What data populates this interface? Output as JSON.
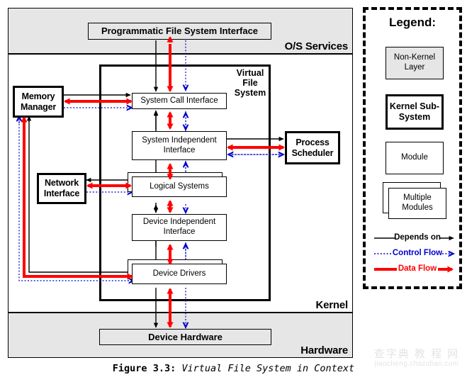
{
  "figure": {
    "caption_number": "Figure 3.3:",
    "caption_title": "Virtual File System in Context"
  },
  "layers": [
    {
      "name": "os-services",
      "label": "O/S Services",
      "fill": "#e6e6e6"
    },
    {
      "name": "kernel",
      "label": "Kernel",
      "fill": "#ffffff"
    },
    {
      "name": "hardware",
      "label": "Hardware",
      "fill": "#e6e6e6"
    }
  ],
  "subsystem": {
    "label": "Virtual\nFile\nSystem"
  },
  "nodes": {
    "programmatic_file_system_interface": "Programmatic File System Interface",
    "memory_manager": "Memory\nManager",
    "network_interface": "Network\nInterface",
    "process_scheduler": "Process\nScheduler",
    "system_call_interface": "System Call Interface",
    "system_independent_interface": "System Independent\nInterface",
    "logical_systems": "Logical Systems",
    "device_independent_interface": "Device Independent\nInterface",
    "device_drivers": "Device Drivers",
    "device_hardware": "Device Hardware"
  },
  "legend": {
    "title": "Legend:",
    "swatches": [
      {
        "name": "non-kernel-layer",
        "label": "Non-Kernel\nLayer",
        "style": "gray-thin"
      },
      {
        "name": "kernel-sub-system",
        "label": "Kernel Sub-\nSystem",
        "style": "white-bold"
      },
      {
        "name": "module",
        "label": "Module",
        "style": "white-thin"
      },
      {
        "name": "multiple-modules",
        "label": "Multiple\nModules",
        "style": "white-stacked"
      }
    ],
    "arrows": [
      {
        "name": "depends-on",
        "label": "Depends on",
        "color": "#000000",
        "line": "solid"
      },
      {
        "name": "control-flow",
        "label": "Control Flow",
        "color": "#0000cc",
        "line": "dotted"
      },
      {
        "name": "data-flow",
        "label": "Data Flow",
        "color": "#ff0000",
        "line": "thick-solid"
      }
    ]
  },
  "watermark": {
    "cn": "查字典 教 程 网",
    "en": "jiaocheng.chazidian.com"
  },
  "colors": {
    "depends_on": "#000000",
    "control_flow": "#0000cc",
    "data_flow": "#ff0000",
    "layer_gray": "#e6e6e6"
  }
}
